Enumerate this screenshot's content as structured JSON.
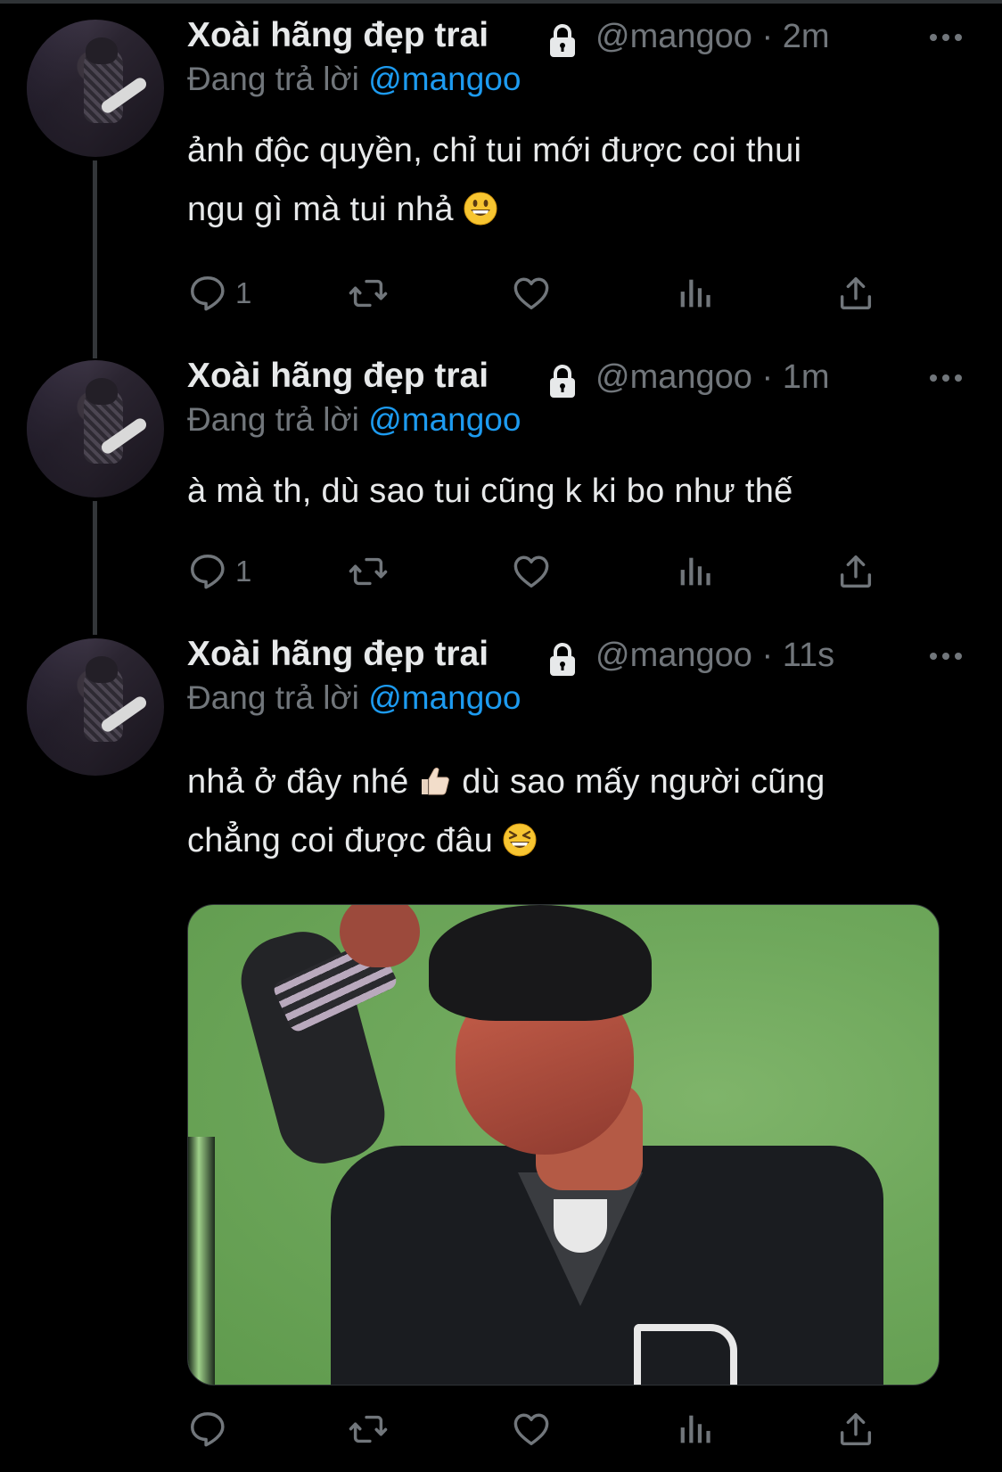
{
  "tweets": [
    {
      "display_name": "Xoài hãng đẹp trai",
      "handle": "@mangoo",
      "time": "2m",
      "replying_prefix": "Đang trả lời",
      "replying_to": "@mangoo",
      "lines": [
        "ảnh độc quyền, chỉ tui mới được coi thui",
        "ngu gì mà tui nhả"
      ],
      "emoji": "grinning-face",
      "reply_count": "1"
    },
    {
      "display_name": "Xoài hãng đẹp trai",
      "handle": "@mangoo",
      "time": "1m",
      "replying_prefix": "Đang trả lời",
      "replying_to": "@mangoo",
      "lines": [
        "à mà th, dù sao tui cũng k ki bo như thế"
      ],
      "reply_count": "1"
    },
    {
      "display_name": "Xoài hãng đẹp trai",
      "handle": "@mangoo",
      "time": "11s",
      "replying_prefix": "Đang trả lời",
      "replying_to": "@mangoo",
      "line1_a": "nhả ở đây nhé",
      "line1_b": "dù sao mấy người cũng",
      "line2": "chẳng coi được đâu",
      "emojis": [
        "thumbs-up",
        "grinning-squinting-face"
      ],
      "reply_count": ""
    }
  ],
  "colors": {
    "background": "#000000",
    "text": "#e7e9ea",
    "muted": "#71767b",
    "link": "#1d9bf0"
  },
  "icons": [
    "lock-icon",
    "more-icon",
    "reply-icon",
    "retweet-icon",
    "like-icon",
    "views-icon",
    "share-icon"
  ]
}
